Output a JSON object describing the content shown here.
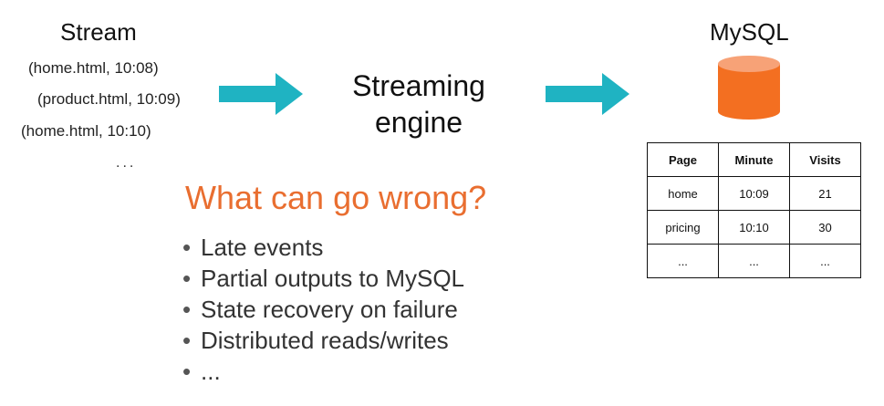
{
  "stream": {
    "title": "Stream",
    "events": [
      "(home.html,  10:08)",
      "(product.html,  10:09)",
      "(home.html, 10:10)"
    ],
    "ellipsis": "..."
  },
  "engine": {
    "line1": "Streaming",
    "line2": "engine"
  },
  "mysql": {
    "title": "MySQL"
  },
  "colors": {
    "arrow": "#1fb3c2",
    "db": "#f36f21",
    "db_top": "#f7a277",
    "question": "#e96e30"
  },
  "question": "What can go wrong?",
  "bullets": [
    "Late events",
    "Partial outputs to MySQL",
    "State recovery on failure",
    "Distributed reads/writes",
    "..."
  ],
  "table": {
    "headers": [
      "Page",
      "Minute",
      "Visits"
    ],
    "rows": [
      [
        "home",
        "10:09",
        "21"
      ],
      [
        "pricing",
        "10:10",
        "30"
      ],
      [
        "...",
        "...",
        "..."
      ]
    ]
  }
}
